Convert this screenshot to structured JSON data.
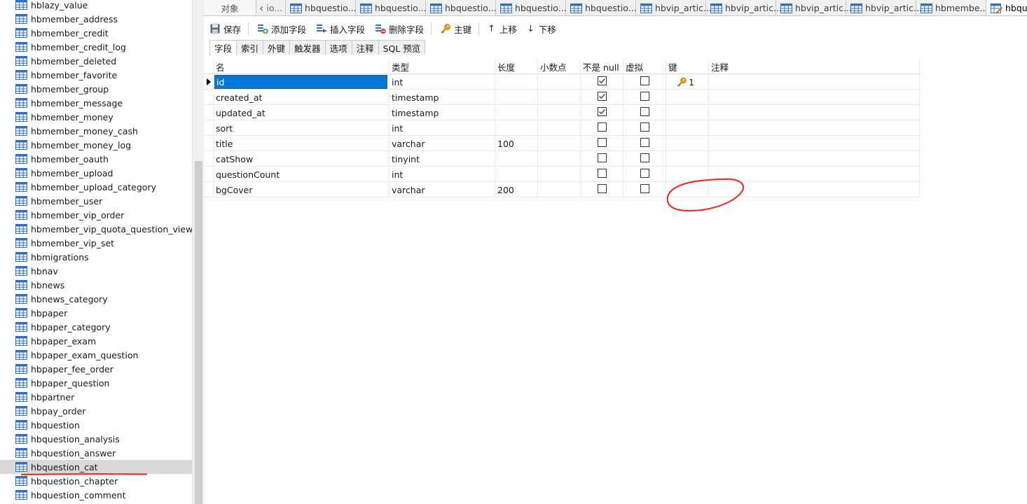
{
  "sidebar": {
    "items": [
      {
        "label": "hblazy_value"
      },
      {
        "label": "hbmember_address"
      },
      {
        "label": "hbmember_credit"
      },
      {
        "label": "hbmember_credit_log"
      },
      {
        "label": "hbmember_deleted"
      },
      {
        "label": "hbmember_favorite"
      },
      {
        "label": "hbmember_group"
      },
      {
        "label": "hbmember_message"
      },
      {
        "label": "hbmember_money"
      },
      {
        "label": "hbmember_money_cash"
      },
      {
        "label": "hbmember_money_log"
      },
      {
        "label": "hbmember_oauth"
      },
      {
        "label": "hbmember_upload"
      },
      {
        "label": "hbmember_upload_category"
      },
      {
        "label": "hbmember_user"
      },
      {
        "label": "hbmember_vip_order"
      },
      {
        "label": "hbmember_vip_quota_question_view"
      },
      {
        "label": "hbmember_vip_set"
      },
      {
        "label": "hbmigrations"
      },
      {
        "label": "hbnav"
      },
      {
        "label": "hbnews"
      },
      {
        "label": "hbnews_category"
      },
      {
        "label": "hbpaper"
      },
      {
        "label": "hbpaper_category"
      },
      {
        "label": "hbpaper_exam"
      },
      {
        "label": "hbpaper_exam_question"
      },
      {
        "label": "hbpaper_fee_order"
      },
      {
        "label": "hbpaper_question"
      },
      {
        "label": "hbpartner"
      },
      {
        "label": "hbpay_order"
      },
      {
        "label": "hbquestion"
      },
      {
        "label": "hbquestion_analysis"
      },
      {
        "label": "hbquestion_answer"
      },
      {
        "label": "hbquestion_cat",
        "selected": true
      },
      {
        "label": "hbquestion_chapter"
      },
      {
        "label": "hbquestion_comment"
      }
    ],
    "annotation_color": "#e8332c"
  },
  "tabs": {
    "objects": "对象",
    "items": [
      {
        "label": "io...",
        "kind": "chev"
      },
      {
        "label": "hbquestio...",
        "kind": "std"
      },
      {
        "label": "hbquestio...",
        "kind": "std"
      },
      {
        "label": "hbquestio...",
        "kind": "std"
      },
      {
        "label": "hbquestio...",
        "kind": "std"
      },
      {
        "label": "hbquestio...",
        "kind": "std"
      },
      {
        "label": "hbvip_artic...",
        "kind": "std"
      },
      {
        "label": "hbvip_artic...",
        "kind": "std"
      },
      {
        "label": "hbvip_artic...",
        "kind": "std"
      },
      {
        "label": "hbvip_artic...",
        "kind": "std"
      },
      {
        "label": "hbmembe...",
        "kind": "std"
      },
      {
        "label": "hbqu",
        "kind": "active"
      }
    ]
  },
  "toolbar": {
    "save": "保存",
    "add_field": "添加字段",
    "insert_field": "插入字段",
    "delete_field": "删除字段",
    "primary_key": "主键",
    "move_up": "上移",
    "move_down": "下移"
  },
  "subtabs": [
    "字段",
    "索引",
    "外键",
    "触发器",
    "选项",
    "注释",
    "SQL 预览"
  ],
  "grid": {
    "headers": {
      "name": "名",
      "type": "类型",
      "length": "长度",
      "decimals": "小数点",
      "not_null": "不是 null",
      "virtual": "虚拟",
      "key": "键",
      "comment": "注释"
    },
    "rows": [
      {
        "name": "id",
        "type": "int",
        "length": "",
        "decimals": "",
        "not_null": true,
        "virtual": false,
        "key": "1",
        "comment": "",
        "selected": true
      },
      {
        "name": "created_at",
        "type": "timestamp",
        "length": "",
        "decimals": "",
        "not_null": true,
        "virtual": false,
        "key": "",
        "comment": ""
      },
      {
        "name": "updated_at",
        "type": "timestamp",
        "length": "",
        "decimals": "",
        "not_null": true,
        "virtual": false,
        "key": "",
        "comment": ""
      },
      {
        "name": "sort",
        "type": "int",
        "length": "",
        "decimals": "",
        "not_null": false,
        "virtual": false,
        "key": "",
        "comment": ""
      },
      {
        "name": "title",
        "type": "varchar",
        "length": "100",
        "decimals": "",
        "not_null": false,
        "virtual": false,
        "key": "",
        "comment": ""
      },
      {
        "name": "catShow",
        "type": "tinyint",
        "length": "",
        "decimals": "",
        "not_null": false,
        "virtual": false,
        "key": "",
        "comment": ""
      },
      {
        "name": "questionCount",
        "type": "int",
        "length": "",
        "decimals": "",
        "not_null": false,
        "virtual": false,
        "key": "",
        "comment": ""
      },
      {
        "name": "bgCover",
        "type": "varchar",
        "length": "200",
        "decimals": "",
        "not_null": false,
        "virtual": false,
        "key": "",
        "comment": ""
      }
    ]
  },
  "colors": {
    "selection": "#0078d7",
    "annotation": "#e8332c",
    "icon_blue": "#2f6fbf"
  },
  "icons": {
    "table": "table-icon",
    "key": "key-icon",
    "save": "save-icon",
    "add": "add-field-icon",
    "insert": "insert-field-icon",
    "delete": "delete-field-icon"
  }
}
